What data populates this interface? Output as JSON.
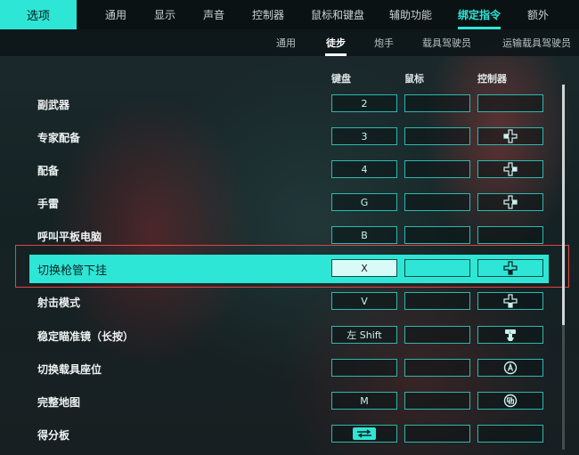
{
  "top_nav": {
    "options_label": "选项",
    "tabs": [
      {
        "label": "通用",
        "active": false
      },
      {
        "label": "显示",
        "active": false
      },
      {
        "label": "声音",
        "active": false
      },
      {
        "label": "控制器",
        "active": false
      },
      {
        "label": "鼠标和键盘",
        "active": false
      },
      {
        "label": "辅助功能",
        "active": false
      },
      {
        "label": "绑定指令",
        "active": true
      },
      {
        "label": "额外",
        "active": false
      }
    ]
  },
  "sub_nav": {
    "tabs": [
      {
        "label": "通用",
        "active": false
      },
      {
        "label": "徒步",
        "active": true
      },
      {
        "label": "炮手",
        "active": false
      },
      {
        "label": "载具驾驶员",
        "active": false
      },
      {
        "label": "运输载具驾驶员",
        "active": false
      }
    ]
  },
  "columns": {
    "keyboard": "键盘",
    "mouse": "鼠标",
    "controller": "控制器"
  },
  "rows": [
    {
      "label": "副武器",
      "keyboard": "2",
      "mouse": "",
      "controller": "",
      "controller_icon": ""
    },
    {
      "label": "专家配备",
      "keyboard": "3",
      "mouse": "",
      "controller": "",
      "controller_icon": "dpad-left-icon"
    },
    {
      "label": "配备",
      "keyboard": "4",
      "mouse": "",
      "controller": "",
      "controller_icon": "dpad-right-icon"
    },
    {
      "label": "手雷",
      "keyboard": "G",
      "mouse": "",
      "controller": "",
      "controller_icon": "dpad-right-icon"
    },
    {
      "label": "呼叫平板电脑",
      "keyboard": "B",
      "mouse": "",
      "controller": "",
      "controller_icon": ""
    },
    {
      "label": "切换枪管下挂",
      "keyboard": "X",
      "mouse": "",
      "controller": "",
      "controller_icon": "dpad-down-icon",
      "selected": true
    },
    {
      "label": "射击模式",
      "keyboard": "V",
      "mouse": "",
      "controller": "",
      "controller_icon": "dpad-down-icon"
    },
    {
      "label": "稳定瞄准镜（长按）",
      "keyboard": "左 Shift",
      "mouse": "",
      "controller": "",
      "controller_icon": "left-stick-icon"
    },
    {
      "label": "切换载具座位",
      "keyboard": "",
      "mouse": "",
      "controller": "",
      "controller_icon": "button-a-icon"
    },
    {
      "label": "完整地图",
      "keyboard": "M",
      "mouse": "",
      "controller": "",
      "controller_icon": "view-button-icon"
    },
    {
      "label": "得分板",
      "keyboard": "",
      "mouse": "",
      "controller": "",
      "keyboard_icon": "tab-key-icon",
      "controller_icon": ""
    }
  ],
  "colors": {
    "accent": "#2ee6d6",
    "selection_outline": "#e04545"
  }
}
